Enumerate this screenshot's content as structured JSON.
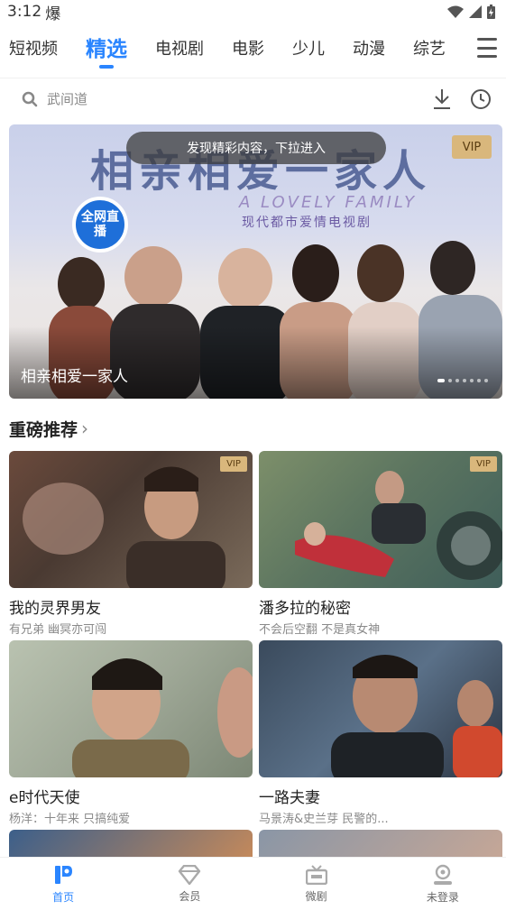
{
  "status_bar": {
    "time": "3:12",
    "hot_symbol": "爆"
  },
  "top_tabs": [
    {
      "label": "短视频",
      "active": false
    },
    {
      "label": "精选",
      "active": true
    },
    {
      "label": "电视剧",
      "active": false
    },
    {
      "label": "电影",
      "active": false
    },
    {
      "label": "少儿",
      "active": false
    },
    {
      "label": "动漫",
      "active": false
    },
    {
      "label": "综艺",
      "active": false
    }
  ],
  "search": {
    "placeholder": "武间道"
  },
  "banner": {
    "pull_hint": "发现精彩内容，下拉进入",
    "vip_label": "VIP",
    "title_art": "相亲相爱一家人",
    "english_art": "A LOVELY FAMILY",
    "subtitle_art": "现代都市爱情电视剧",
    "live_badge": "全网直播",
    "caption": "相亲相爱一家人",
    "dot_count": 7,
    "active_dot": 0
  },
  "section": {
    "title": "重磅推荐",
    "arrow": "›"
  },
  "cards": [
    {
      "title": "我的灵界男友",
      "subtitle": "有兄弟 幽冥亦可闯",
      "vip": "VIP"
    },
    {
      "title": "潘多拉的秘密",
      "subtitle": "不会后空翻 不是真女神",
      "vip": "VIP"
    },
    {
      "title": "e时代天使",
      "subtitle": "杨洋：十年来 只搞纯爱",
      "vip": ""
    },
    {
      "title": "一路夫妻",
      "subtitle": "马景涛&史兰芽 民警的...",
      "vip": ""
    }
  ],
  "bottom_nav": [
    {
      "label": "首页",
      "icon": "home-logo-icon",
      "active": true
    },
    {
      "label": "会员",
      "icon": "diamond-icon",
      "active": false
    },
    {
      "label": "微剧",
      "icon": "tv-icon",
      "active": false
    },
    {
      "label": "未登录",
      "icon": "user-icon",
      "active": false
    }
  ],
  "colors": {
    "accent": "#2a85ff",
    "vip_gold": "#d9b77c",
    "text_primary": "#222222",
    "text_secondary": "#8a8a8a"
  }
}
